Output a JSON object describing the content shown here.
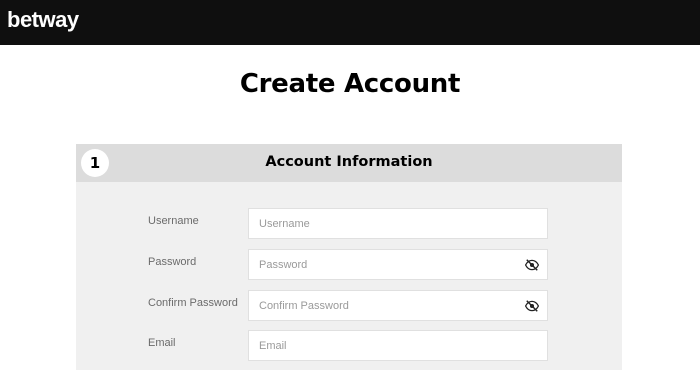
{
  "header": {
    "logo_text": "betway",
    "background": "#0f0f0f"
  },
  "page": {
    "title": "Create Account"
  },
  "section": {
    "step_number": "1",
    "title": "Account Information"
  },
  "form": {
    "fields": [
      {
        "label": "Username",
        "placeholder": "Username",
        "value": "",
        "type": "text",
        "icon": null
      },
      {
        "label": "Password",
        "placeholder": "Password",
        "value": "",
        "type": "password",
        "icon": "eye-slash-icon"
      },
      {
        "label": "Confirm Password",
        "placeholder": "Confirm Password",
        "value": "",
        "type": "password",
        "icon": "eye-slash-icon"
      },
      {
        "label": "Email",
        "placeholder": "Email",
        "value": "",
        "type": "email",
        "icon": null
      }
    ]
  }
}
